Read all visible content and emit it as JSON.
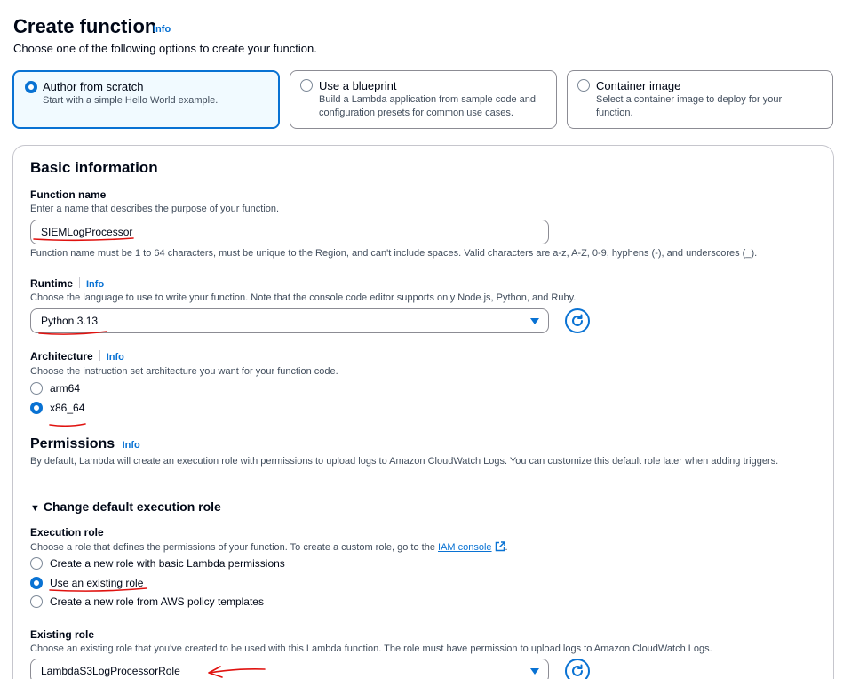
{
  "header": {
    "title": "Create function",
    "info": "Info",
    "subtitle": "Choose one of the following options to create your function."
  },
  "options": [
    {
      "title": "Author from scratch",
      "description_lines": [
        "Start with a simple Hello World example.",
        ""
      ],
      "selected": true
    },
    {
      "title": "Use a blueprint",
      "description_lines": [
        "Build a Lambda application from sample code and",
        "configuration presets for common use cases."
      ],
      "selected": false
    },
    {
      "title": "Container image",
      "description_lines": [
        "Select a container image to deploy for your",
        "function."
      ],
      "selected": false
    }
  ],
  "basic": {
    "title": "Basic information",
    "function_name": {
      "label": "Function name",
      "description": "Enter a name that describes the purpose of your function.",
      "value": "SIEMLogProcessor",
      "constraint": "Function name must be 1 to 64 characters, must be unique to the Region, and can't include spaces. Valid characters are a-z, A-Z, 0-9, hyphens (-), and underscores (_)."
    },
    "runtime": {
      "label": "Runtime",
      "info": "Info",
      "description": "Choose the language to use to write your function. Note that the console code editor supports only Node.js, Python, and Ruby.",
      "value": "Python 3.13"
    },
    "architecture": {
      "label": "Architecture",
      "info": "Info",
      "description": "Choose the instruction set architecture you want for your function code.",
      "options": [
        {
          "label": "arm64",
          "selected": false
        },
        {
          "label": "x86_64",
          "selected": true
        }
      ]
    }
  },
  "permissions": {
    "title": "Permissions",
    "info": "Info",
    "description": "By default, Lambda will create an execution role with permissions to upload logs to Amazon CloudWatch Logs. You can customize this default role later when adding triggers.",
    "expander": "Change default execution role",
    "execution_role": {
      "label": "Execution role",
      "description": "Choose a role that defines the permissions of your function. To create a custom role, go to the",
      "link": "IAM console",
      "trailing": ".",
      "options": [
        {
          "label": "Create a new role with basic Lambda permissions",
          "selected": false
        },
        {
          "label": "Use an existing role",
          "selected": true
        },
        {
          "label": "Create a new role from AWS policy templates",
          "selected": false
        }
      ]
    },
    "existing_role": {
      "label": "Existing role",
      "description": "Choose an existing role that you've created to be used with this Lambda function. The role must have permission to upload logs to Amazon CloudWatch Logs.",
      "value": "LambdaS3LogProcessorRole"
    }
  },
  "colors": {
    "accent": "#0972d3",
    "annotation": "#e0120f",
    "selected_tile_bg": "#f1faff"
  },
  "icons": [
    "refresh-icon",
    "caret-down-icon",
    "external-link-icon",
    "expand-triangle-icon"
  ]
}
